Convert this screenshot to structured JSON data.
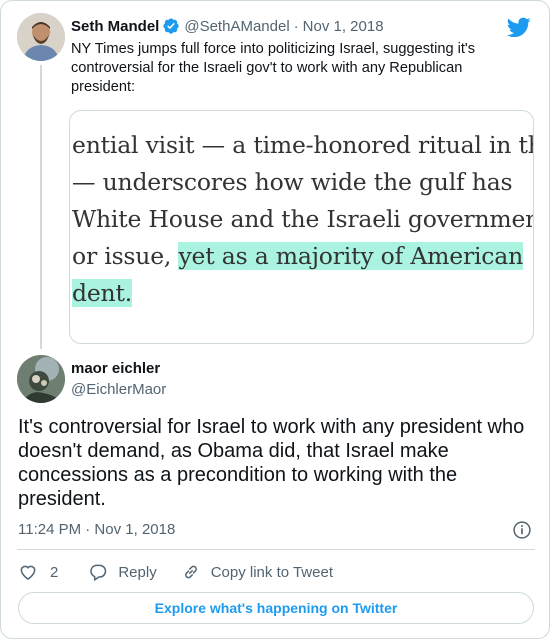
{
  "parent_tweet": {
    "author_name": "Seth Mandel",
    "handle": "@SethAMandel",
    "separator": "·",
    "date": "Nov 1, 2018",
    "text": "NY Times jumps full force into politicizing Israel, suggesting it's controversial for the Israeli gov't to work with any Republican president:",
    "media_clip": {
      "lines": [
        {
          "pre": "ential visit — a time-honored ritual in the",
          "highlight": ""
        },
        {
          "pre": "— underscores how wide the gulf has",
          "highlight": ""
        },
        {
          "pre": "White House and the Israeli government",
          "highlight": ""
        },
        {
          "pre": "or issue, ",
          "highlight": "yet as a majority of American"
        },
        {
          "pre": "",
          "highlight": "dent."
        }
      ],
      "highlight_color": "#a9f3e0"
    }
  },
  "main_tweet": {
    "author_name": "maor eichler",
    "handle": "@EichlerMaor",
    "text": "It's controversial for Israel to work with any president who doesn't demand, as Obama did, that Israel make concessions as a precondition to working with the president.",
    "timestamp": "11:24 PM · Nov 1, 2018"
  },
  "actions": {
    "like_count": "2",
    "reply_label": "Reply",
    "copy_label": "Copy link to Tweet"
  },
  "explore_label": "Explore what's happening on Twitter",
  "colors": {
    "brand_blue": "#1d9bf0",
    "secondary_text": "#536471",
    "border": "#cfd9de"
  },
  "icons": [
    "verified-badge-icon",
    "twitter-bird-icon",
    "info-icon",
    "heart-icon",
    "reply-icon",
    "link-icon"
  ]
}
